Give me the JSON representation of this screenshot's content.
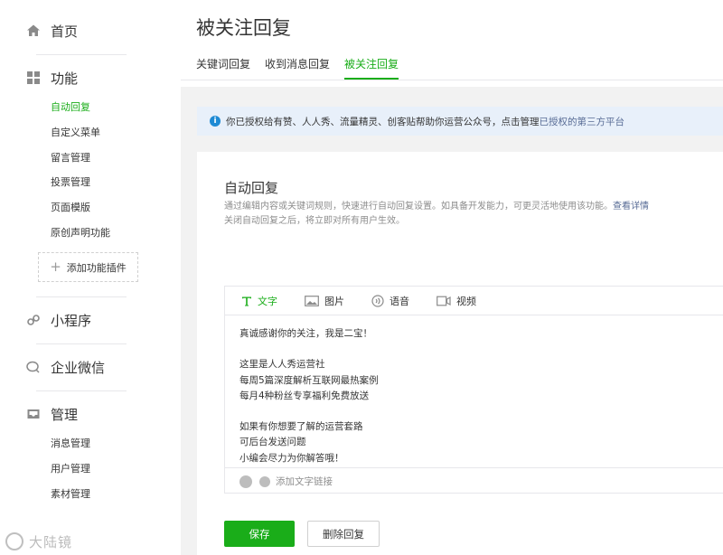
{
  "sidebar": {
    "home_label": "首页",
    "features": {
      "title": "功能",
      "items": [
        {
          "label": "自动回复",
          "active": true
        },
        {
          "label": "自定义菜单"
        },
        {
          "label": "留言管理"
        },
        {
          "label": "投票管理"
        },
        {
          "label": "页面模版"
        },
        {
          "label": "原创声明功能"
        }
      ],
      "add_plugin": "添加功能插件"
    },
    "mini_program": "小程序",
    "enterprise_wechat": "企业微信",
    "management": {
      "title": "管理",
      "items": [
        {
          "label": "消息管理"
        },
        {
          "label": "用户管理"
        },
        {
          "label": "素材管理"
        }
      ]
    },
    "watermark": "大陆镜"
  },
  "page": {
    "title": "被关注回复",
    "tabs": [
      {
        "label": "关键词回复"
      },
      {
        "label": "收到消息回复"
      },
      {
        "label": "被关注回复",
        "active": true
      }
    ]
  },
  "notice": {
    "text": "你已授权给有赞、人人秀、流量精灵、创客贴帮助你运营公众号，点击管理",
    "link": "已授权的第三方平台"
  },
  "auto_reply": {
    "title": "自动回复",
    "desc_line1": "通过编辑内容或关键词规则，快速进行自动回复设置。如具备开发能力，可更灵活地使用该功能。",
    "desc_link": "查看详情",
    "desc_line2": "关闭自动回复之后，将立即对所有用户生效。"
  },
  "editor": {
    "tabs": [
      {
        "label": "文字",
        "icon": "text-icon",
        "active": true
      },
      {
        "label": "图片",
        "icon": "image-icon"
      },
      {
        "label": "语音",
        "icon": "voice-icon"
      },
      {
        "label": "视频",
        "icon": "video-icon"
      }
    ],
    "content": "真诚感谢你的关注，我是二宝！\n\n这里是人人秀运营社\n每周5篇深度解析互联网最热案例\n每月4种粉丝专享福利免费放送\n\n如果有你想要了解的运营套路\n可后台发送问题\n小编会尽力为你解答哦！",
    "add_link": "添加文字链接"
  },
  "actions": {
    "save": "保存",
    "delete": "删除回复"
  },
  "colors": {
    "accent": "#1aad19",
    "link": "#576b95",
    "notice_bg": "#e8f0fa",
    "info": "#1e8ad4"
  }
}
